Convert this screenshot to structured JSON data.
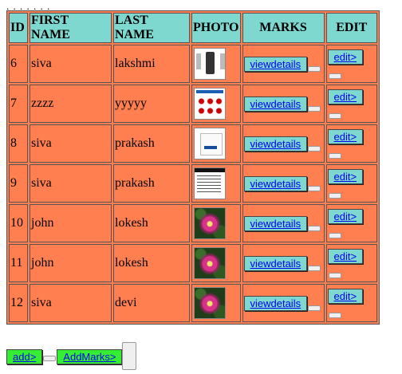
{
  "top_dots": ". . . . . . .",
  "table": {
    "headers": {
      "id": "ID",
      "first_name": "FIRST NAME",
      "last_name": "LAST NAME",
      "photo": "PHOTO",
      "marks": "MARKS",
      "edit": "EDIT"
    },
    "rows": [
      {
        "id": "6",
        "first_name": "siva",
        "last_name": "lakshmi",
        "photo": "shirt-product-image",
        "marks_link": "viewdetails",
        "edit_link": "edit>"
      },
      {
        "id": "7",
        "first_name": "zzzz",
        "last_name": "yyyyy",
        "photo": "product-grid-screenshot",
        "marks_link": "viewdetails",
        "edit_link": "edit>"
      },
      {
        "id": "8",
        "first_name": "siva",
        "last_name": "prakash",
        "photo": "form-screenshot",
        "marks_link": "viewdetails",
        "edit_link": "edit>"
      },
      {
        "id": "9",
        "first_name": "siva",
        "last_name": "prakash",
        "photo": "document-screenshot",
        "marks_link": "viewdetails",
        "edit_link": "edit>"
      },
      {
        "id": "10",
        "first_name": "john",
        "last_name": "lokesh",
        "photo": "pink-flower-photo",
        "marks_link": "viewdetails",
        "edit_link": "edit>"
      },
      {
        "id": "11",
        "first_name": "john",
        "last_name": "lokesh",
        "photo": "pink-flower-photo",
        "marks_link": "viewdetails",
        "edit_link": "edit>"
      },
      {
        "id": "12",
        "first_name": "siva",
        "last_name": "devi",
        "photo": "pink-flower-photo",
        "marks_link": "viewdetails",
        "edit_link": "edit>"
      }
    ]
  },
  "actions": {
    "add_label": "add>",
    "add_marks_label": "AddMarks>"
  },
  "colors": {
    "table_bg": "#ff7f50",
    "header_bg": "#7fd8d0",
    "action_green": "#33ee33",
    "link": "#0000ee"
  }
}
